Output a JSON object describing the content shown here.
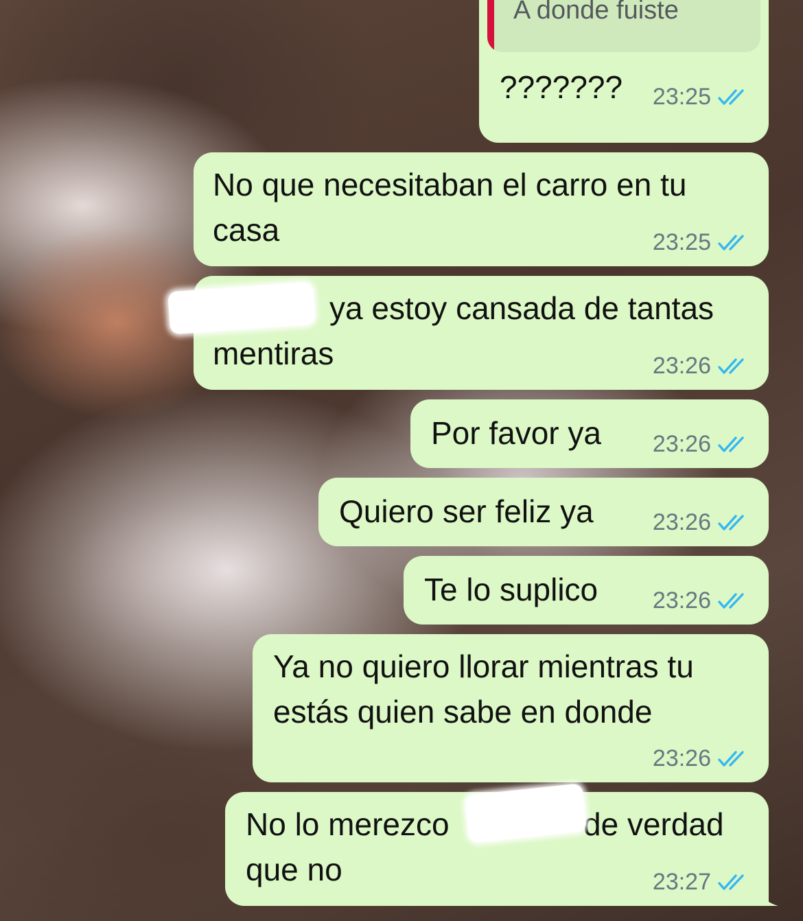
{
  "chat": {
    "quoted": "A donde fuiste",
    "messages": [
      {
        "text": "???????",
        "time": "23:25"
      },
      {
        "text": "No que necesitaban el carro en tu\ncasa",
        "time": "23:25"
      },
      {
        "text": "ya estoy cansada de tantas\nmentiras",
        "time": "23:26"
      },
      {
        "text": "Por favor ya",
        "time": "23:26"
      },
      {
        "text": "Quiero ser feliz ya",
        "time": "23:26"
      },
      {
        "text": "Te lo suplico",
        "time": "23:26"
      },
      {
        "text": "Ya no quiero llorar mientras tu\nestás quien sabe en donde",
        "time": "23:26"
      },
      {
        "text": "No lo merezco",
        "text_end": "de verdad",
        "text_line2": "que no",
        "time": "23:27"
      }
    ]
  },
  "colors": {
    "bubble": "#dcf8c6",
    "time": "#667781",
    "read_ticks": "#34b7f1",
    "quote_bar": "#d4123a"
  },
  "icons": {
    "read_receipt": "double-check-icon"
  }
}
